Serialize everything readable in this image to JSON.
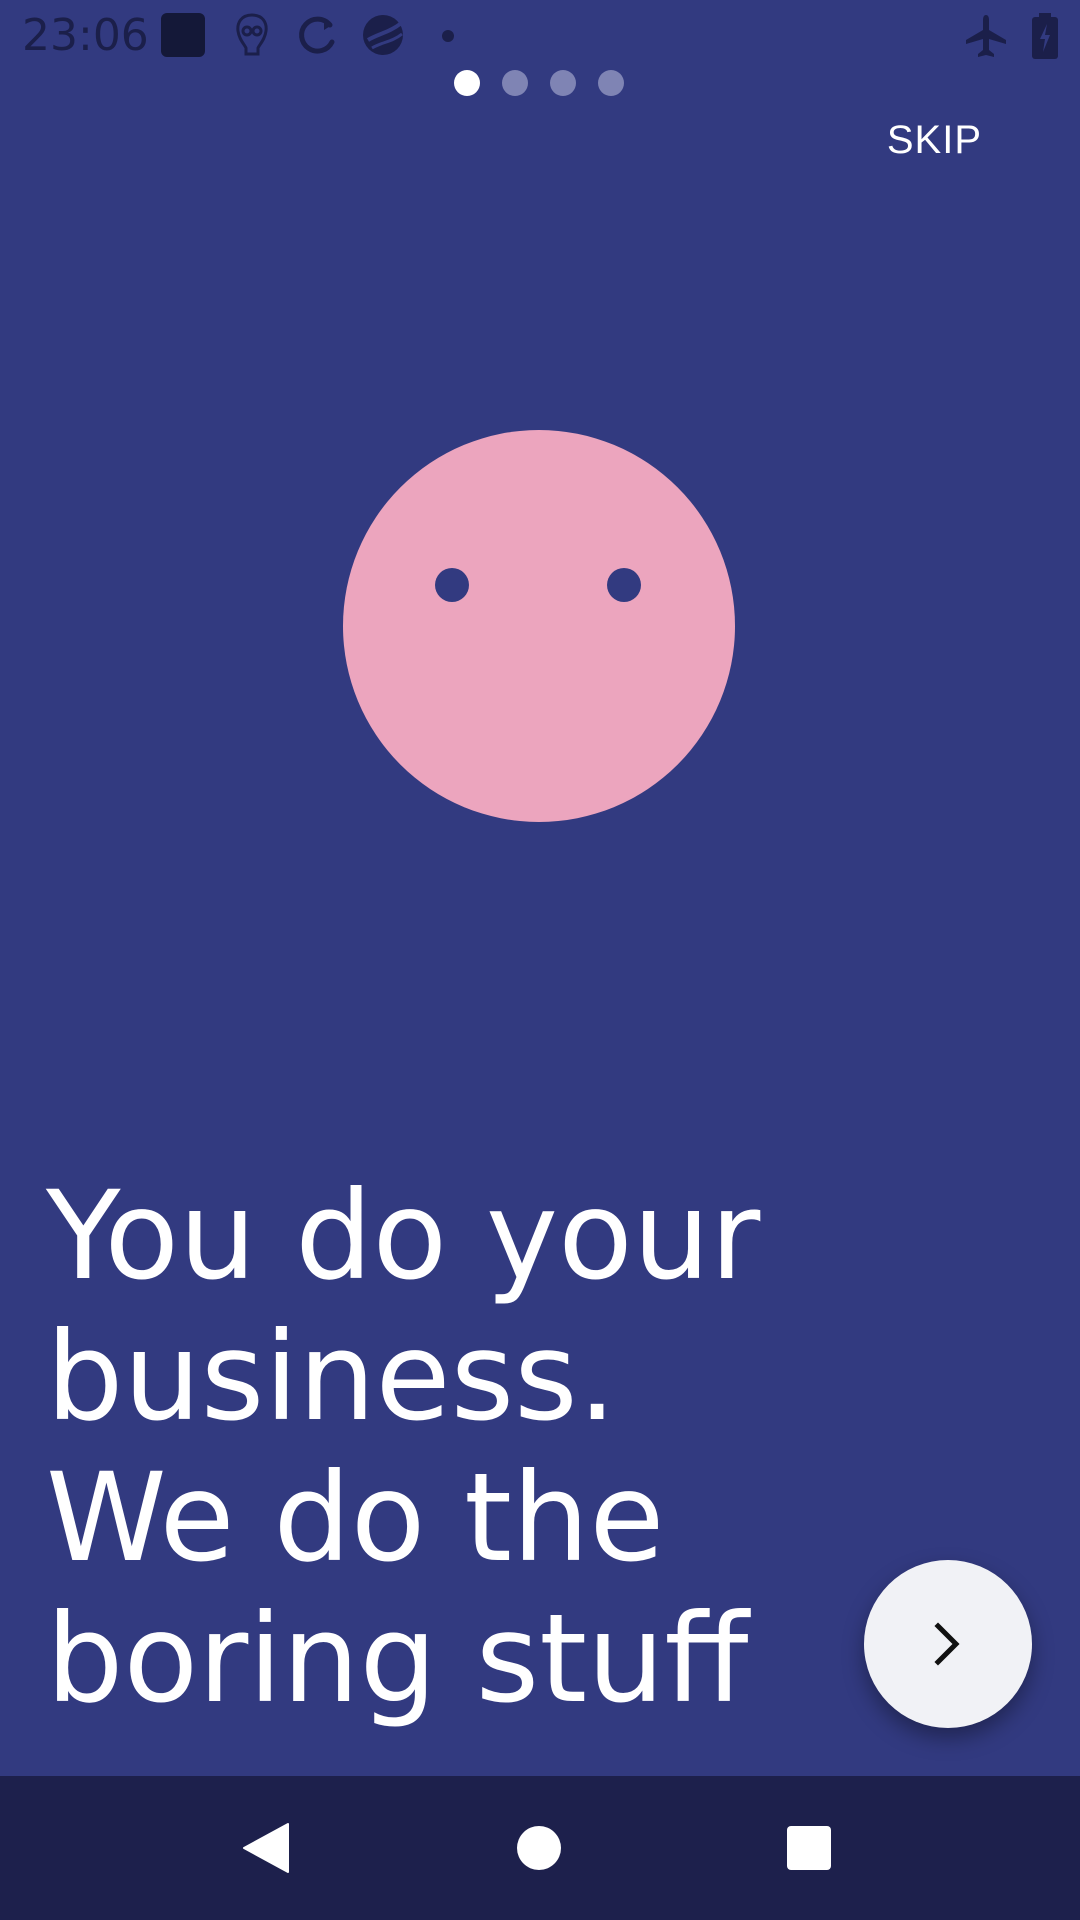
{
  "status_bar": {
    "time": "23:06",
    "icons": [
      "notification-square-icon",
      "robot-icon",
      "sync-icon",
      "ball-icon",
      "dot-icon",
      "airplane-mode-icon",
      "battery-charging-icon"
    ]
  },
  "onboarding": {
    "page_count": 4,
    "current_page": 1,
    "skip_label": "SKIP",
    "headline_lines": [
      "You do your",
      "business.",
      "We do the",
      "boring stuff"
    ],
    "next_icon": "chevron-right-icon"
  },
  "navigation_bar": {
    "icons": [
      "back-icon",
      "home-icon",
      "recents-icon"
    ]
  },
  "colors": {
    "background": "#323a80",
    "face": "#eca5be",
    "nav_bar": "#1d204c",
    "fab": "#f1f2f6",
    "text": "#ffffff",
    "dot_inactive": "#7f84b4"
  }
}
